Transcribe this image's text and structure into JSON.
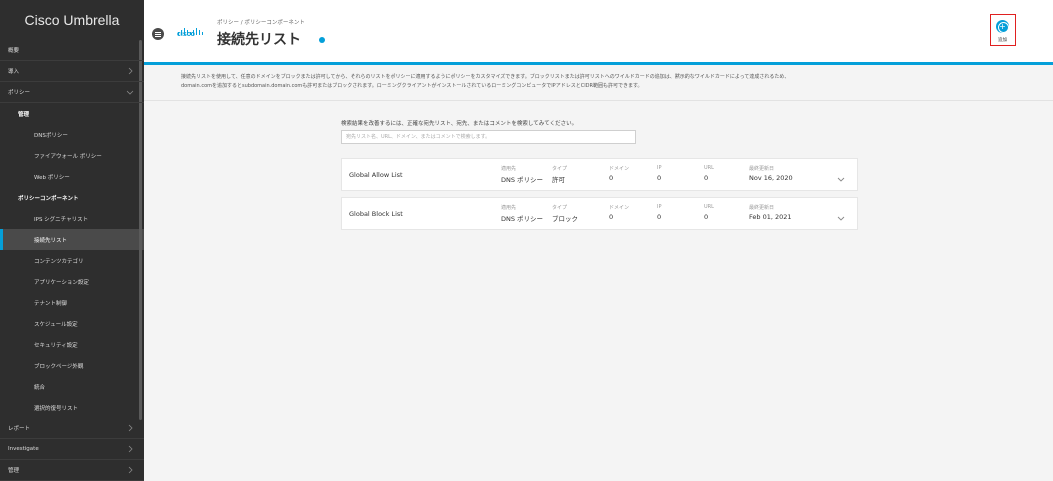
{
  "sidebar": {
    "brand": "Cisco Umbrella",
    "items": [
      {
        "label": "概要"
      },
      {
        "label": "導入"
      },
      {
        "label": "ポリシー"
      },
      {
        "label": "管理"
      },
      {
        "label": "DNSポリシー"
      },
      {
        "label": "ファイアウォール ポリシー"
      },
      {
        "label": "Web ポリシー"
      },
      {
        "label": "ポリシーコンポーネント"
      },
      {
        "label": "IPS シグニチャリスト"
      },
      {
        "label": "接続先リスト"
      },
      {
        "label": "コンテンツカテゴリ"
      },
      {
        "label": "アプリケーション設定"
      },
      {
        "label": "テナント制御"
      },
      {
        "label": "スケジュール設定"
      },
      {
        "label": "セキュリティ設定"
      },
      {
        "label": "ブロックページ外観"
      },
      {
        "label": "統合"
      },
      {
        "label": "選択的復号リスト"
      },
      {
        "label": "レポート"
      },
      {
        "label": "Investigate"
      },
      {
        "label": "管理"
      }
    ]
  },
  "header": {
    "logo_text": "cisco",
    "breadcrumb": "ポリシー / ポリシーコンポーネント",
    "title": "接続先リスト",
    "add_label": "追加"
  },
  "banner": {
    "line1": "接続先リストを使用して、任意のドメインをブロックまたは許可してから、それらのリストをポリシーに適用するようにポリシーをカスタマイズできます。ブロックリストまたは許可リストへのワイルドカードの追加は、黙示的なワイルドカードによって達成されるため、",
    "line2": "domain.comを追加するとsubdomain.domain.comも許可またはブロックされます。ローミングクライアントがインストールされているローミングコンピュータでIPアドレスとCIDR範囲も許可できます。"
  },
  "search": {
    "hint": "検索結果を改善するには、正確な宛先リスト、宛先、またはコメントを検索してみてください。",
    "placeholder": "宛先リスト名、URL、ドメイン、またはコメントで検索します。"
  },
  "columns": {
    "applied_to": "適用先",
    "type": "タイプ",
    "domains": "ドメイン",
    "ip": "IP",
    "url": "URL",
    "last_modified": "最終更新日"
  },
  "lists": [
    {
      "name": "Global Allow List",
      "applied_to": "DNS ポリシー",
      "type": "許可",
      "domains": "0",
      "ip": "0",
      "url": "0",
      "last_modified": "Nov 16, 2020"
    },
    {
      "name": "Global Block List",
      "applied_to": "DNS ポリシー",
      "type": "ブロック",
      "domains": "0",
      "ip": "0",
      "url": "0",
      "last_modified": "Feb 01, 2021"
    }
  ],
  "colors": {
    "accent": "#049fd9",
    "sidebar_bg": "#2e2e2e",
    "highlight_box": "#e02020"
  }
}
